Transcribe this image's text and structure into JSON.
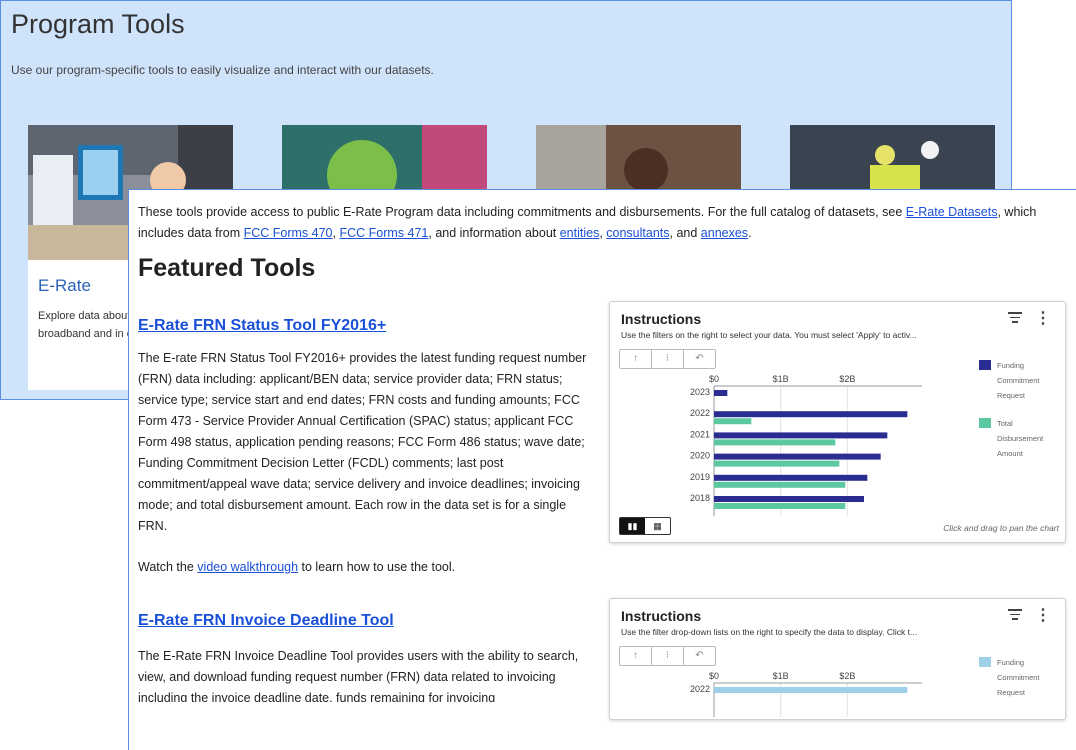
{
  "back": {
    "title": "Program Tools",
    "subtitle": "Use our program-specific tools to easily visualize and interact with our datasets.",
    "erate_card": {
      "title": "E-Rate",
      "text": "Explore data about libraries that rece broadband and in connections"
    }
  },
  "front": {
    "intro": {
      "p1": "These tools provide access to public E-Rate Program data including commitments and disbursements. For the full catalog of datasets, see ",
      "link_datasets": "E-Rate Datasets",
      "p2": ", which includes data from ",
      "link_470": "FCC Forms 470",
      "p3": ", ",
      "link_471": "FCC Forms 471",
      "p4": ", and information about ",
      "link_entities": "entities",
      "p5": ", ",
      "link_consultants": "consultants",
      "p6": ", and ",
      "link_annexes": "annexes",
      "p7": "."
    },
    "featured_heading": "Featured Tools",
    "tool1": {
      "title": "E-Rate FRN Status Tool FY2016+",
      "description": "The E-rate FRN Status Tool FY2016+ provides the latest funding request number (FRN) data including: applicant/BEN data; service provider data; FRN status; service type;  service start and end dates; FRN costs and funding amounts; FCC Form 473 - Service Provider Annual Certification (SPAC) status; applicant FCC Form 498 status, application pending reasons; FCC Form 486 status; wave date; Funding Commitment Decision Letter (FCDL) comments; last post commitment/appeal wave data;  service delivery and invoice deadlines; invoicing mode; and total disbursement amount.  Each row in the data set is for a single FRN.",
      "walk_pre": "Watch the ",
      "walk_link": "video walkthrough",
      "walk_post": " to learn how to use the tool."
    },
    "tool2": {
      "title": "E-Rate FRN Invoice Deadline Tool",
      "description": "The E-Rate FRN Invoice Deadline Tool provides users with the ability to search, view, and download funding request number (FRN) data related to invoicing including the invoice deadline date, funds remaining for invoicing"
    }
  },
  "widget1": {
    "title": "Instructions",
    "subtitle": "Use the filters on the right to select your data. You must select 'Apply' to activ...",
    "toolbar": [
      "↑",
      "⁝",
      "↶"
    ],
    "footer_note": "Click and drag to pan the chart",
    "legend": [
      {
        "name": "Funding Commitment Request",
        "color": "#2b2c92"
      },
      {
        "name": "Total Disbursement Amount",
        "color": "#5cc8a0"
      }
    ]
  },
  "widget2": {
    "title": "Instructions",
    "subtitle": "Use the filter drop-down lists on the right to specify the data to display. Click t...",
    "toolbar": [
      "↑",
      "⁝",
      "↶"
    ],
    "legend": [
      {
        "name": "Funding Commitment Request",
        "color": "#9fd0e9"
      }
    ]
  },
  "chart_data": [
    {
      "type": "bar",
      "orientation": "horizontal",
      "categories": [
        "2023",
        "2022",
        "2021",
        "2020",
        "2019",
        "2018"
      ],
      "x_ticks": [
        "$0",
        "$1B",
        "$2B"
      ],
      "xlim": [
        0,
        3000000000
      ],
      "series": [
        {
          "name": "Funding Commitment Request",
          "color": "#2b2c92",
          "values": [
            200000000,
            2900000000,
            2600000000,
            2500000000,
            2300000000,
            2250000000
          ]
        },
        {
          "name": "Total Disbursement Amount",
          "color": "#5cc8a0",
          "values": null,
          "values_list": [
            0,
            560000000,
            1820000000,
            1880000000,
            1970000000,
            1970000000
          ]
        }
      ]
    },
    {
      "type": "bar",
      "orientation": "horizontal",
      "categories": [
        "2022"
      ],
      "x_ticks": [
        "$0",
        "$1B",
        "$2B"
      ],
      "xlim": [
        0,
        3000000000
      ],
      "series": [
        {
          "name": "Funding Commitment Request",
          "color": "#9fd0e9",
          "values": [
            2900000000
          ]
        }
      ]
    }
  ]
}
